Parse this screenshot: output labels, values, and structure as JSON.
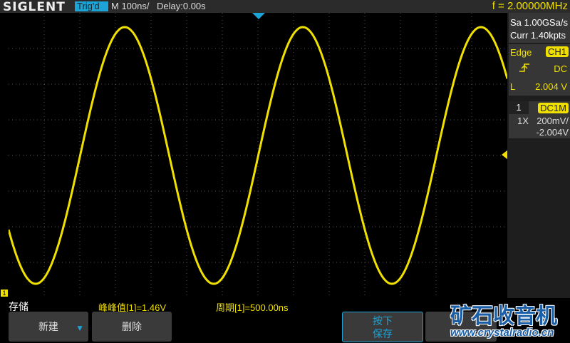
{
  "header": {
    "brand": "SIGLENT",
    "trig_status": "Trig'd",
    "timebase": "M 100ns/",
    "delay": "Delay:0.00s",
    "frequency": "f = 2.00000MHz"
  },
  "acq": {
    "sample_rate": "Sa 1.00GSa/s",
    "memory": "Curr 1.40kpts"
  },
  "trigger": {
    "type": "Edge",
    "source": "CH1",
    "coupling": "DC",
    "level_label": "L",
    "level": "2.004 V"
  },
  "channel": {
    "number": "1",
    "coupling": "DC1M",
    "probe": "1X",
    "scale": "200mV/",
    "offset": "-2.004V"
  },
  "channel_marker": "1",
  "bottom": {
    "menu_title": "存储",
    "measure1": "峰峰值[1]=1.46V",
    "measure2": "周期[1]=500.00ns"
  },
  "softkeys": {
    "new": "新建",
    "delete": "删除",
    "press_save_1": "按下",
    "press_save_2": "保存"
  },
  "watermark": {
    "title": "矿石收音机",
    "url": "www.crystalradio.cn"
  },
  "colors": {
    "trace": "#f0e000",
    "accent": "#1ca3d8"
  },
  "waveform": {
    "type": "sine",
    "period_ns": 500,
    "timebase_ns_per_div": 100,
    "vpp_V": 1.46
  }
}
